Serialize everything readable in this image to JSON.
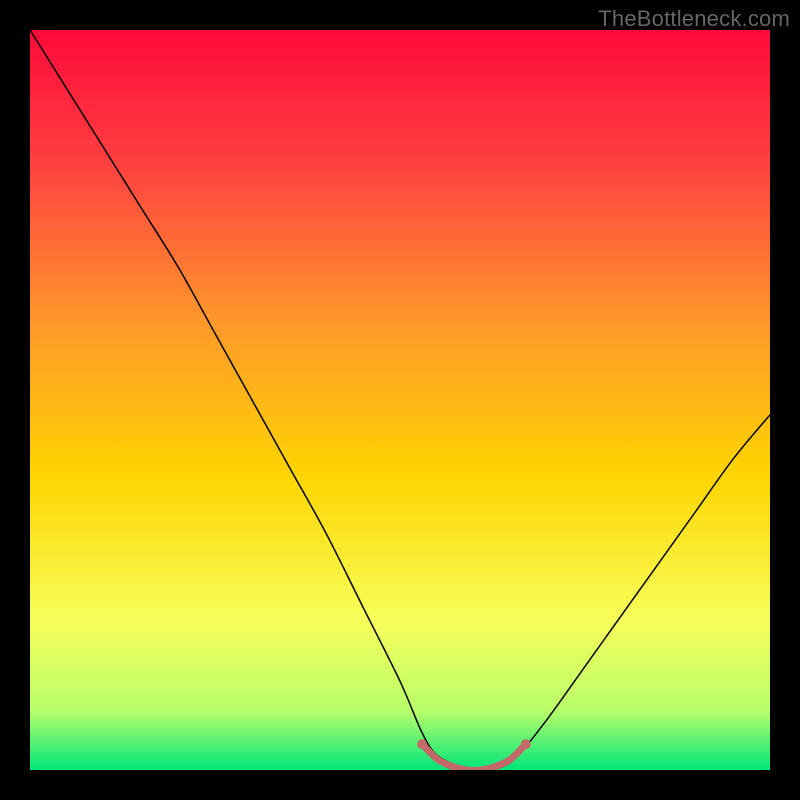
{
  "watermark": "TheBottleneck.com",
  "chart_data": {
    "type": "line",
    "title": "",
    "xlabel": "",
    "ylabel": "",
    "xlim": [
      0,
      100
    ],
    "ylim": [
      0,
      100
    ],
    "grid": false,
    "legend": false,
    "annotations": [],
    "background_gradient": {
      "direction": "vertical",
      "stops": [
        {
          "pos": 0.0,
          "color": "#ff0a3a"
        },
        {
          "pos": 0.18,
          "color": "#ff4040"
        },
        {
          "pos": 0.4,
          "color": "#ff9a2a"
        },
        {
          "pos": 0.6,
          "color": "#ffd400"
        },
        {
          "pos": 0.8,
          "color": "#f6ff5a"
        },
        {
          "pos": 0.92,
          "color": "#b8ff6a"
        },
        {
          "pos": 1.0,
          "color": "#00e57a"
        }
      ]
    },
    "series": [
      {
        "name": "bottleneck-curve",
        "color": "#000000",
        "stroke_width": 1.5,
        "x": [
          0,
          5,
          10,
          15,
          20,
          25,
          30,
          35,
          40,
          45,
          50,
          53,
          55,
          58,
          60,
          62,
          64,
          66,
          70,
          75,
          80,
          85,
          90,
          95,
          100
        ],
        "values": [
          100,
          92,
          84,
          76,
          68,
          59,
          50,
          41,
          32,
          22,
          12,
          5,
          2,
          0.5,
          0,
          0,
          0.5,
          2,
          7,
          14,
          21,
          28,
          35,
          42,
          48
        ]
      },
      {
        "name": "optimal-band",
        "color": "#c4696a",
        "stroke_width": 7,
        "x": [
          53,
          55,
          57,
          59,
          61,
          63,
          65,
          67
        ],
        "values": [
          3.5,
          1.5,
          0.5,
          0,
          0,
          0.5,
          1.5,
          3.5
        ]
      }
    ],
    "optimal_band_markers": {
      "color": "#c4696a",
      "radius": 5,
      "points": [
        {
          "x": 53,
          "y": 3.5
        },
        {
          "x": 67,
          "y": 3.5
        }
      ]
    }
  }
}
